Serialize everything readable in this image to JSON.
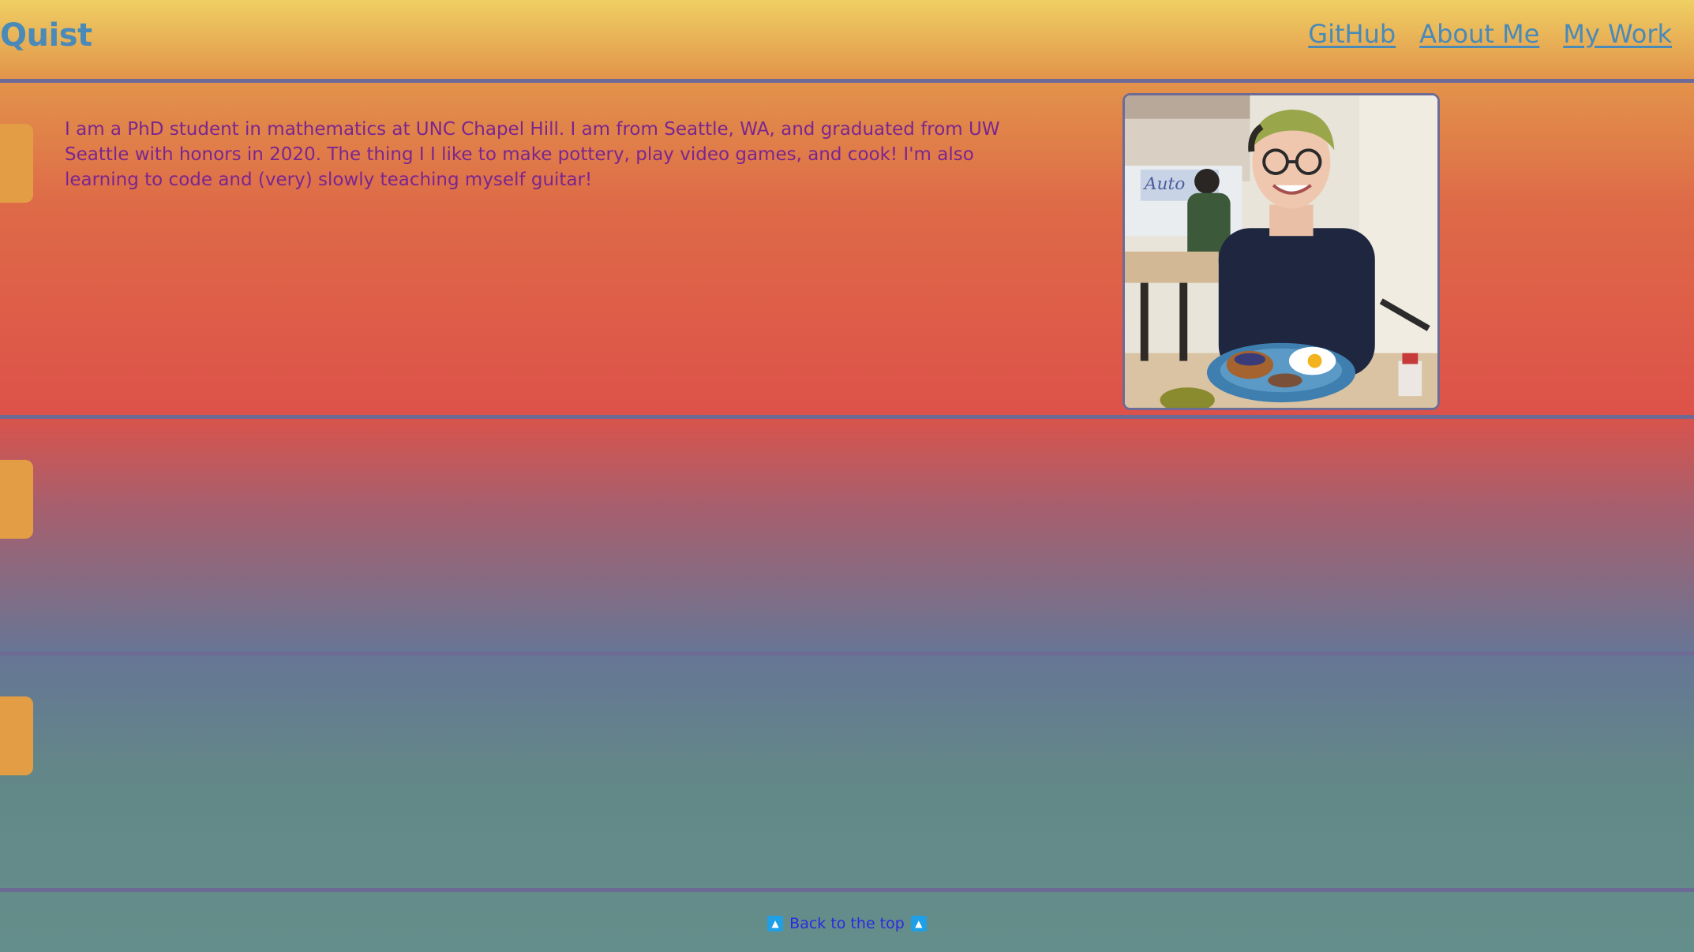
{
  "header": {
    "title": "Quist",
    "nav": [
      {
        "label": "GitHub"
      },
      {
        "label": "About Me"
      },
      {
        "label": "My Work"
      }
    ]
  },
  "about": {
    "bio": "I am a PhD student in mathematics at UNC Chapel Hill. I am from Seattle, WA, and graduated from UW Seattle with honors in 2020. The thing I I like to make pottery, play video games, and cook! I'm also learning to code and (very) slowly teaching myself guitar!",
    "photo_alt": "Portrait photo"
  },
  "footer": {
    "back_to_top": "Back to the top"
  },
  "colors": {
    "title_link": "#4a8ab8",
    "bio_text": "#7a2590",
    "divider": "#6e6a96",
    "side_tab": "#e39e45",
    "back_link": "#2a2ae0",
    "up_icon": "#1e9fe6"
  },
  "icons": {
    "up": "arrow-up-icon"
  }
}
